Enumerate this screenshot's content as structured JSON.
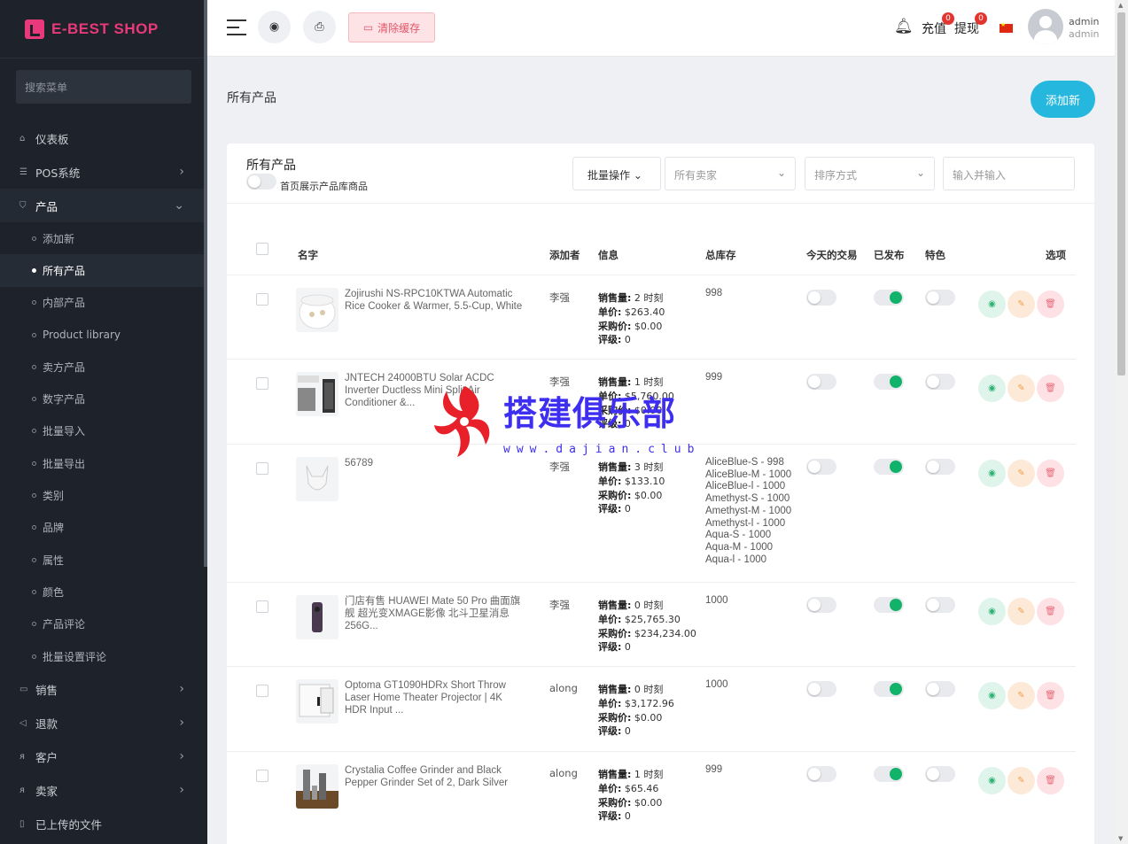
{
  "brand": {
    "name": "E-BEST SHOP",
    "color": "#e9397a"
  },
  "sidebar": {
    "search_placeholder": "搜索菜单",
    "items": [
      {
        "label": "仪表板",
        "icon": "home-icon"
      },
      {
        "label": "POS系统",
        "icon": "list-icon"
      },
      {
        "label": "产品",
        "icon": "cart-icon"
      },
      {
        "label": "销售",
        "icon": "sales-icon"
      },
      {
        "label": "退款",
        "icon": "refund-icon"
      },
      {
        "label": "客户",
        "icon": "users-icon"
      },
      {
        "label": "卖家",
        "icon": "user-icon"
      },
      {
        "label": "已上传的文件",
        "icon": "file-icon"
      }
    ],
    "product_sub": [
      "添加新",
      "所有产品",
      "内部产品",
      "Product library",
      "卖方产品",
      "数字产品",
      "批量导入",
      "批量导出",
      "类别",
      "品牌",
      "属性",
      "颜色",
      "产品评论",
      "批量设置评论"
    ]
  },
  "topbar": {
    "clear_cache": "清除缓存",
    "recharge": "充值",
    "recharge_count": "0",
    "withdraw": "提现",
    "withdraw_count": "0",
    "user_name": "admin",
    "user_role": "admin"
  },
  "page": {
    "title": "所有产品",
    "add_new": "添加新"
  },
  "card": {
    "title": "所有产品",
    "homepage_toggle_label": "首页展示产品库商品",
    "bulk_action": "批量操作",
    "seller_filter": "所有卖家",
    "sort_by": "排序方式",
    "search_placeholder": "输入并输入"
  },
  "table": {
    "headers": {
      "name": "名字",
      "added_by": "添加者",
      "info": "信息",
      "total_stock": "总库存",
      "todays_deal": "今天的交易",
      "published": "已发布",
      "featured": "特色",
      "options": "选项"
    },
    "info_labels": {
      "sales": "销售量:",
      "times": "时刻",
      "unit_price": "单价:",
      "purchase_price": "采购价:",
      "rating": "评级:"
    },
    "rows": [
      {
        "name": "Zojirushi NS-RPC10KTWA Automatic Rice Cooker & Warmer, 5.5-Cup, White",
        "added_by": "李强",
        "sales": "2",
        "unit_price": "$263.40",
        "purchase_price": "$0.00",
        "rating": "0",
        "stock": [
          "998"
        ],
        "todays_deal": false,
        "published": true,
        "featured": false
      },
      {
        "name": "JNTECH 24000BTU Solar ACDC Inverter Ductless Mini Split Air Conditioner &...",
        "added_by": "李强",
        "sales": "1",
        "unit_price": "$5,760.00",
        "purchase_price": "$0.00",
        "rating": "0",
        "stock": [
          "999"
        ],
        "todays_deal": false,
        "published": true,
        "featured": false
      },
      {
        "name": "56789",
        "added_by": "李强",
        "sales": "3",
        "unit_price": "$133.10",
        "purchase_price": "$0.00",
        "rating": "0",
        "stock": [
          "AliceBlue-S - 998",
          "AliceBlue-M - 1000",
          "AliceBlue-l - 1000",
          "Amethyst-S - 1000",
          "Amethyst-M - 1000",
          "Amethyst-l - 1000",
          "Aqua-S - 1000",
          "Aqua-M - 1000",
          "Aqua-l - 1000"
        ],
        "todays_deal": false,
        "published": true,
        "featured": false
      },
      {
        "name": "门店有售 HUAWEI Mate 50 Pro 曲面旗舰 超光变XMAGE影像 北斗卫星消息 256G...",
        "added_by": "李强",
        "sales": "0",
        "unit_price": "$25,765.30",
        "purchase_price": "$234,234.00",
        "rating": "0",
        "stock": [
          "1000"
        ],
        "todays_deal": false,
        "published": true,
        "featured": false
      },
      {
        "name": "Optoma GT1090HDRx Short Throw Laser Home Theater Projector | 4K HDR Input ...",
        "added_by": "along",
        "sales": "0",
        "unit_price": "$3,172.96",
        "purchase_price": "$0.00",
        "rating": "0",
        "stock": [
          "1000"
        ],
        "todays_deal": false,
        "published": true,
        "featured": false
      },
      {
        "name": "Crystalia Coffee Grinder and Black Pepper Grinder Set of 2, Dark Silver",
        "added_by": "along",
        "sales": "1",
        "unit_price": "$65.46",
        "purchase_price": "$0.00",
        "rating": "0",
        "stock": [
          "999"
        ],
        "todays_deal": false,
        "published": true,
        "featured": false
      }
    ]
  },
  "watermark": {
    "text": "搭建俱乐部",
    "url": "www.dajian.club"
  }
}
